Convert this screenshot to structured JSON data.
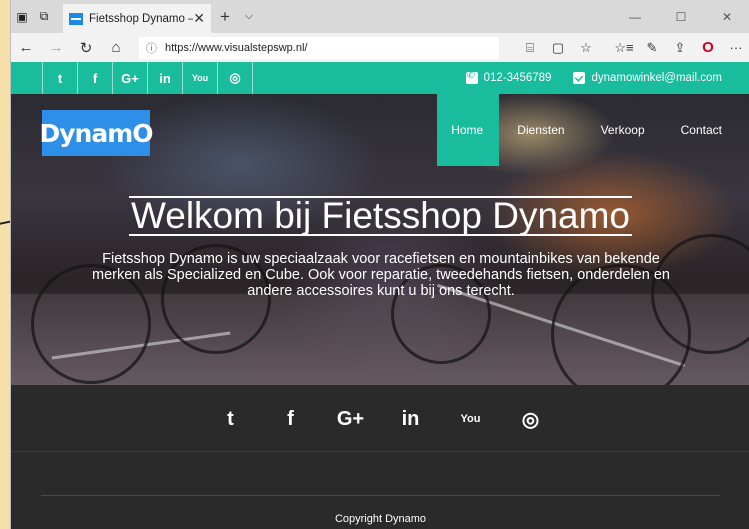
{
  "browser": {
    "tab_title": "Fietsshop Dynamo – Vo",
    "url": "https://www.visualstepswp.nl/",
    "tab_close": "✕",
    "new_tab": "+",
    "tab_menu": "⌵",
    "controls": {
      "minimize": "—",
      "maximize": "☐",
      "close": "✕"
    },
    "nav": {
      "back": "←",
      "forward": "→",
      "refresh": "↻",
      "home": "⌂"
    },
    "url_info_icon": "ⓘ",
    "right_icons": {
      "reader": "📖",
      "reading_view": "▢",
      "favorite": "☆",
      "favorites_hub": "☆≡",
      "notes": "✎",
      "share": "⇪",
      "opera": "O",
      "more": "···"
    }
  },
  "topbar": {
    "social": [
      "t",
      "f",
      "G+",
      "in",
      "You",
      "◎"
    ],
    "phone": "012-3456789",
    "email": "dynamowinkel@mail.com"
  },
  "logo": "DynamO",
  "nav": {
    "items": [
      {
        "label": "Home",
        "active": true
      },
      {
        "label": "Diensten",
        "active": false
      },
      {
        "label": "Verkoop",
        "active": false
      },
      {
        "label": "Contact",
        "active": false
      }
    ]
  },
  "hero": {
    "title": "Welkom bij Fietsshop Dynamo",
    "text": "Fietsshop Dynamo is uw speciaalzaak voor racefietsen en mountainbikes van bekende merken als Specialized en Cube. Ook voor reparatie, tweedehands fietsen, onderdelen en andere accessoires kunt u bij ons terecht."
  },
  "footer": {
    "social": [
      "t",
      "f",
      "G+",
      "in",
      "You",
      "◎"
    ],
    "copyright": "Copyright Dynamo"
  },
  "colors": {
    "accent": "#19bc9c",
    "logo_bg": "#2e8fe8",
    "footer_bg": "#2a2a2a"
  }
}
